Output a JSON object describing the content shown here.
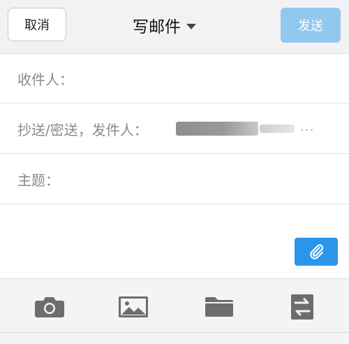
{
  "header": {
    "cancel_label": "取消",
    "title": "写邮件",
    "send_label": "发送"
  },
  "fields": {
    "to_label": "收件人：",
    "cc_bcc_sender_label": "抄送/密送，发件人：",
    "sender_dots": "...",
    "subject_label": "主题："
  },
  "toolbar": {
    "icons": [
      "camera-icon",
      "image-icon",
      "folder-icon",
      "transfer-icon"
    ]
  },
  "colors": {
    "send_button": "#92c8ee",
    "attach_button": "#2b95e9",
    "icon_gray": "#6d6d6d"
  }
}
